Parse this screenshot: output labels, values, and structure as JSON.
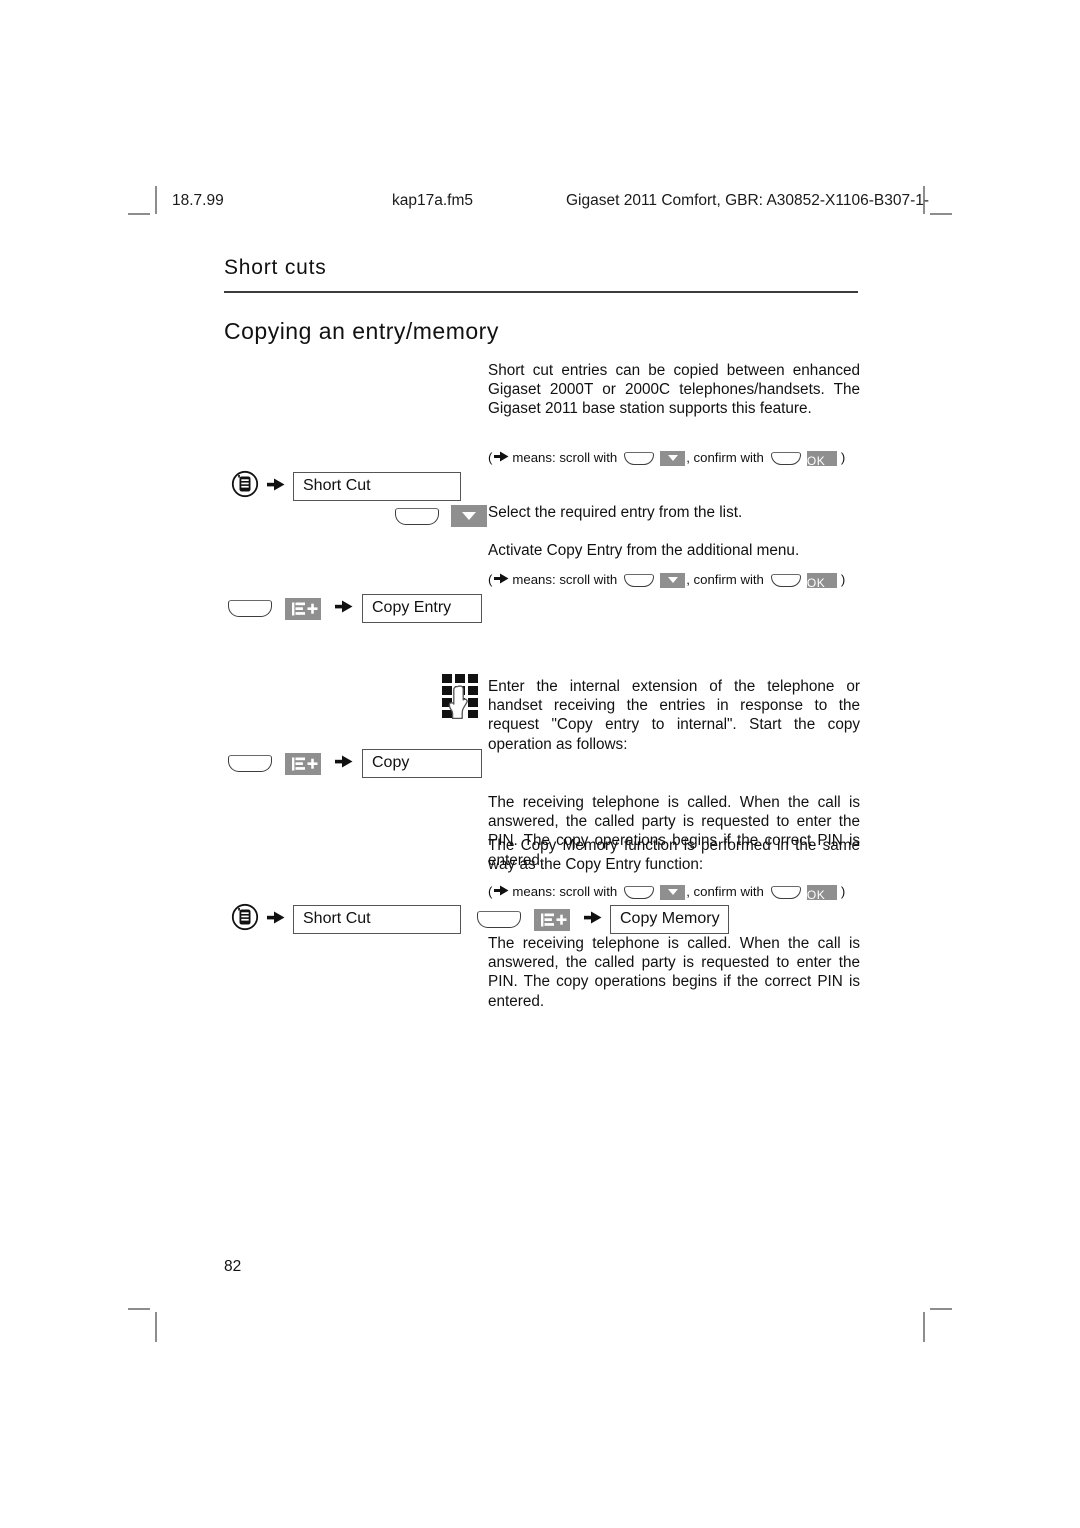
{
  "header": {
    "date": "18.7.99",
    "filename": "kap17a.fm5",
    "document": "Gigaset 2011 Comfort, GBR: A30852-X1106-B307-1-"
  },
  "section": {
    "chapter": "Short cuts",
    "title": "Copying an entry/memory"
  },
  "intro": {
    "paragraph": "Short cut entries can be copied between enhanced Gigaset 2000T or 2000C telephones/handsets. The Gigaset 2011 base station supports this feature."
  },
  "legend": {
    "open_paren": "(",
    "arrow_glyph": "▸",
    "means_text": "means: scroll with",
    "confirm_text": ", confirm with",
    "ok_label": "OK",
    "close_paren": ")"
  },
  "steps": [
    {
      "id": "step-short-cut",
      "menu_icon": "menu-key-icon",
      "arrow": "▸",
      "box_label": "Short Cut"
    },
    {
      "id": "step-scroll",
      "softkey": "soft-key-icon",
      "scroll_key": "down-arrow-key-icon"
    },
    {
      "id": "step-copy-entry",
      "softkey": "soft-key-icon",
      "list_icon": "list-plus-key-icon",
      "arrow": "▸",
      "box_label": "Copy Entry"
    },
    {
      "id": "step-copy",
      "softkey": "soft-key-icon",
      "list_icon": "list-plus-key-icon",
      "arrow": "▸",
      "box_label": "Copy"
    },
    {
      "id": "step-copy-memory",
      "menu_icon": "menu-key-icon",
      "arrow": "▸",
      "box_label": "Short Cut",
      "softkey": "soft-key-icon",
      "list_icon": "list-plus-key-icon",
      "arrow2": "▸",
      "box_label2": "Copy Memory"
    }
  ],
  "instructions": {
    "select_entry": "Select the required entry from the list.",
    "activate_copy_entry": "Activate Copy Entry from the additional menu.",
    "enter_extension": "Enter the internal extension of the telephone or handset receiving the entries in response to the request \"Copy entry to internal\". Start the copy operation as follows:",
    "receiving_called_1": "The receiving telephone is called. When the call is answered, the called party is requested to enter the PIN. The copy operations begins if the correct PIN is entered.",
    "copy_memory_same_way": "The Copy Memory function is performed in the same way as the Copy Entry function:",
    "receiving_called_2": "The receiving telephone is called. When the call is answered, the called party is requested to enter the PIN. The copy operations begins if the correct PIN is entered."
  },
  "icons": {
    "keypad": "keypad-entry-icon"
  },
  "page_number": "82"
}
